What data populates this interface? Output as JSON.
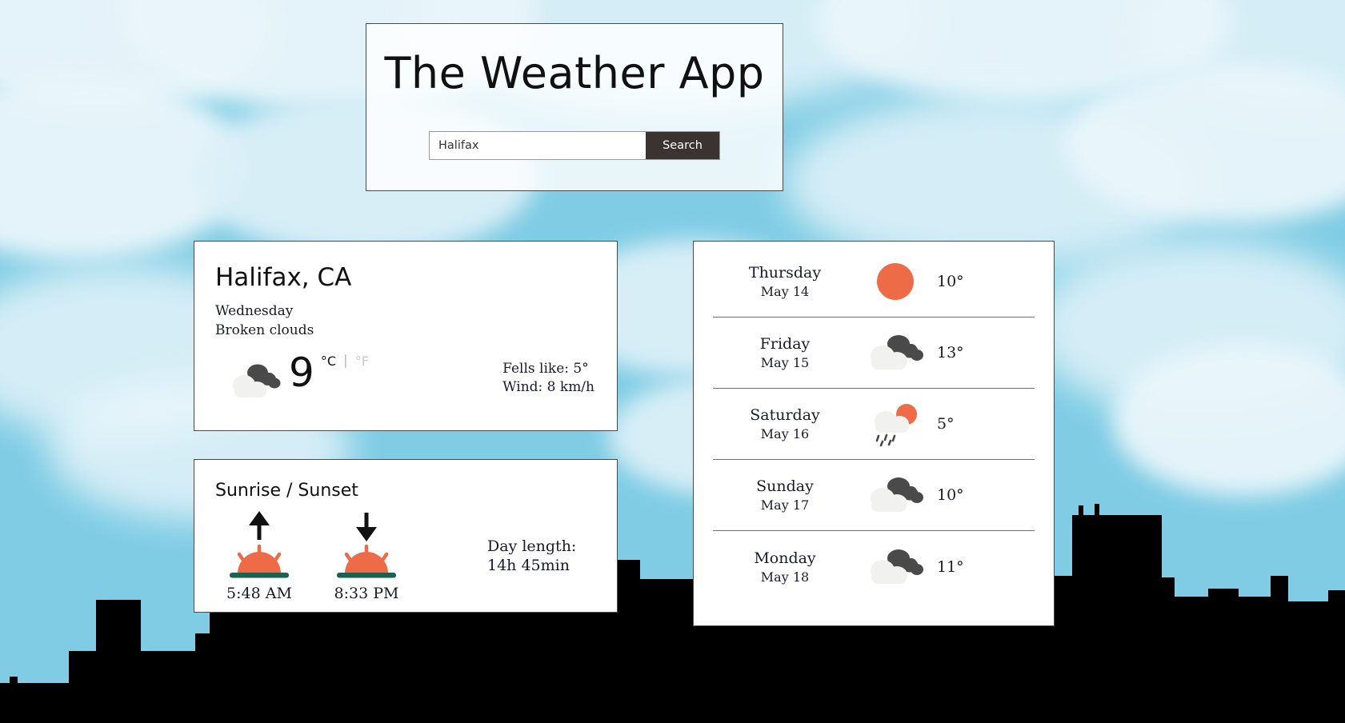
{
  "header": {
    "app_title": "The Weather App",
    "search": {
      "value": "Halifax",
      "placeholder": "Halifax",
      "button_label": "Search"
    }
  },
  "current": {
    "city": "Halifax, CA",
    "day": "Wednesday",
    "description": "Broken clouds",
    "icon": "broken-clouds-icon",
    "temperature": "9",
    "unit_celsius": "°C",
    "unit_separator": "|",
    "unit_fahrenheit": "°F",
    "feels_like": "Fells like: 5°",
    "wind": "Wind: 8 km/h"
  },
  "sun": {
    "title": "Sunrise / Sunset",
    "sunrise_time": "5:48 AM",
    "sunset_time": "8:33 PM",
    "day_length_label": "Day length:",
    "day_length_value": "14h 45min"
  },
  "forecast": [
    {
      "day": "Thursday",
      "date": "May 14",
      "icon": "sun-icon",
      "temp": "10°"
    },
    {
      "day": "Friday",
      "date": "May 15",
      "icon": "broken-clouds-icon",
      "temp": "13°"
    },
    {
      "day": "Saturday",
      "date": "May 16",
      "icon": "sun-rain-shower-icon",
      "temp": "5°"
    },
    {
      "day": "Sunday",
      "date": "May 17",
      "icon": "broken-clouds-icon",
      "temp": "10°"
    },
    {
      "day": "Monday",
      "date": "May 18",
      "icon": "broken-clouds-icon",
      "temp": "11°"
    }
  ],
  "colors": {
    "sky": "#7fcce4",
    "cloud": "#eaf6fb",
    "accent_orange": "#ed6c47",
    "cloud_light": "#f1f1f0",
    "cloud_dark": "#4a4a4a",
    "horizon_green": "#1a6152",
    "button_dark": "#3a332f",
    "silhouette": "#000000"
  }
}
